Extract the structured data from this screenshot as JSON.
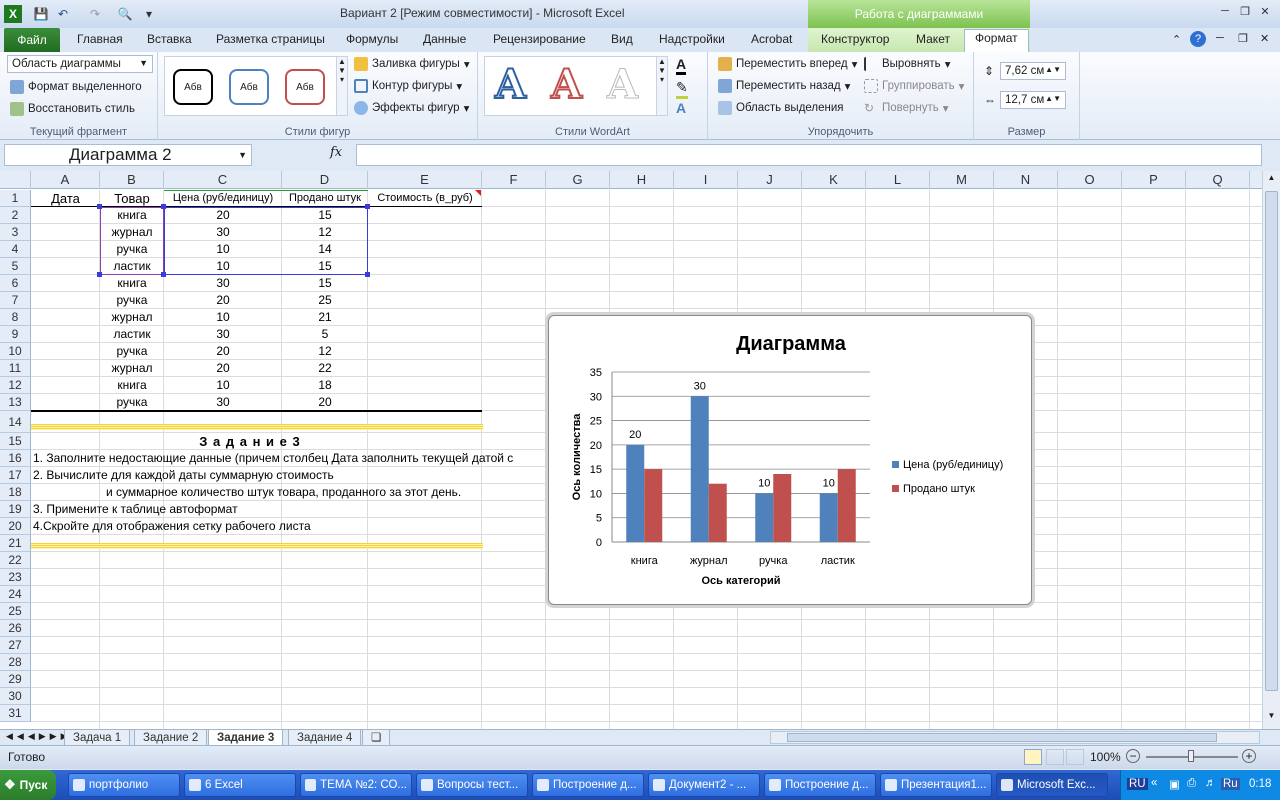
{
  "window": {
    "title": "Вариант 2  [Режим совместимости]  -  Microsoft Excel",
    "context_header": "Работа с диаграммами"
  },
  "tabs": {
    "file": "Файл",
    "items": [
      "Главная",
      "Вставка",
      "Разметка страницы",
      "Формулы",
      "Данные",
      "Рецензирование",
      "Вид",
      "Надстройки",
      "Acrobat"
    ],
    "context": [
      "Конструктор",
      "Макет",
      "Формат"
    ],
    "active": "Формат"
  },
  "ribbon": {
    "current": {
      "combo": "Область диаграммы",
      "format_sel": "Формат выделенного",
      "reset": "Восстановить стиль",
      "label": "Текущий фрагмент"
    },
    "shape_styles": {
      "sample": "Абв",
      "fill": "Заливка фигуры",
      "outline": "Контур фигуры",
      "effects": "Эффекты фигур",
      "label": "Стили фигур"
    },
    "wordart": {
      "glyph": "A",
      "label": "Стили WordArt"
    },
    "arrange": {
      "forward": "Переместить вперед",
      "backward": "Переместить назад",
      "selection": "Область выделения",
      "align": "Выровнять",
      "group": "Группировать",
      "rotate": "Повернуть",
      "label": "Упорядочить"
    },
    "size": {
      "height": "7,62 см",
      "width": "12,7 см",
      "label": "Размер"
    }
  },
  "formula": {
    "name_box": "Диаграмма 2",
    "fx": "fx",
    "value": ""
  },
  "columns": [
    "A",
    "B",
    "C",
    "D",
    "E",
    "F",
    "G",
    "H",
    "I",
    "J",
    "K",
    "L",
    "M",
    "N",
    "O",
    "P",
    "Q"
  ],
  "rows": [
    "1",
    "2",
    "3",
    "4",
    "5",
    "6",
    "7",
    "8",
    "9",
    "10",
    "11",
    "12",
    "13",
    "14",
    "15",
    "16",
    "17",
    "18",
    "19",
    "20",
    "21",
    "22",
    "23",
    "24",
    "25",
    "26",
    "27",
    "28",
    "29",
    "30",
    "31"
  ],
  "table": {
    "headers": [
      "Дата",
      "Товар",
      "Цена (руб/единицу)",
      "Продано штук",
      "Стоимость (в_руб)"
    ],
    "rows": [
      [
        "книга",
        "20",
        "15"
      ],
      [
        "журнал",
        "30",
        "12"
      ],
      [
        "ручка",
        "10",
        "14"
      ],
      [
        "ластик",
        "10",
        "15"
      ],
      [
        "книга",
        "30",
        "15"
      ],
      [
        "ручка",
        "20",
        "25"
      ],
      [
        "журнал",
        "10",
        "21"
      ],
      [
        "ластик",
        "30",
        "5"
      ],
      [
        "ручка",
        "20",
        "12"
      ],
      [
        "журнал",
        "20",
        "22"
      ],
      [
        "книга",
        "10",
        "18"
      ],
      [
        "ручка",
        "30",
        "20"
      ]
    ]
  },
  "task": {
    "title": "З а д а н и е 3",
    "lines": [
      "1. Заполните недостающие данные (причем столбец Дата заполнить текущей датой с",
      "2.  Вычислите для каждой даты суммарную стоимость",
      "и суммарное количество штук товара, проданного  за этот день.",
      "3. Примените к таблице автоформат",
      "4.Скройте для отображения сетку рабочего листа"
    ]
  },
  "chart_data": {
    "type": "bar",
    "title": "Диаграмма",
    "categories": [
      "книга",
      "журнал",
      "ручка",
      "ластик"
    ],
    "series": [
      {
        "name": "Цена (руб/единицу)",
        "values": [
          20,
          30,
          10,
          10
        ],
        "color": "#4f81bd"
      },
      {
        "name": "Продано штук",
        "values": [
          15,
          12,
          14,
          15
        ],
        "color": "#c0504d"
      }
    ],
    "data_labels_series": 0,
    "xlabel": "Ось категорий",
    "ylabel": "Ось количества",
    "ylim": [
      0,
      35
    ],
    "yticks": [
      0,
      5,
      10,
      15,
      20,
      25,
      30,
      35
    ],
    "grid": true,
    "legend": "right"
  },
  "sheet_tabs": {
    "items": [
      "Задача 1",
      "Задание 2",
      "Задание 3",
      "Задание 4"
    ],
    "active": "Задание 3"
  },
  "status": {
    "ready": "Готово",
    "zoom": "100%"
  },
  "taskbar": {
    "start": "Пуск",
    "items": [
      "портфолио",
      "6 Excel",
      "ТЕМА №2: СО...",
      "Вопросы тест...",
      "Построение д...",
      "Документ2 - ...",
      "Построение д...",
      "Презентация1...",
      "Microsoft Exc..."
    ],
    "active": "Microsoft Exc...",
    "lang": "RU",
    "lang2": "Ru",
    "clock": "0:18"
  }
}
